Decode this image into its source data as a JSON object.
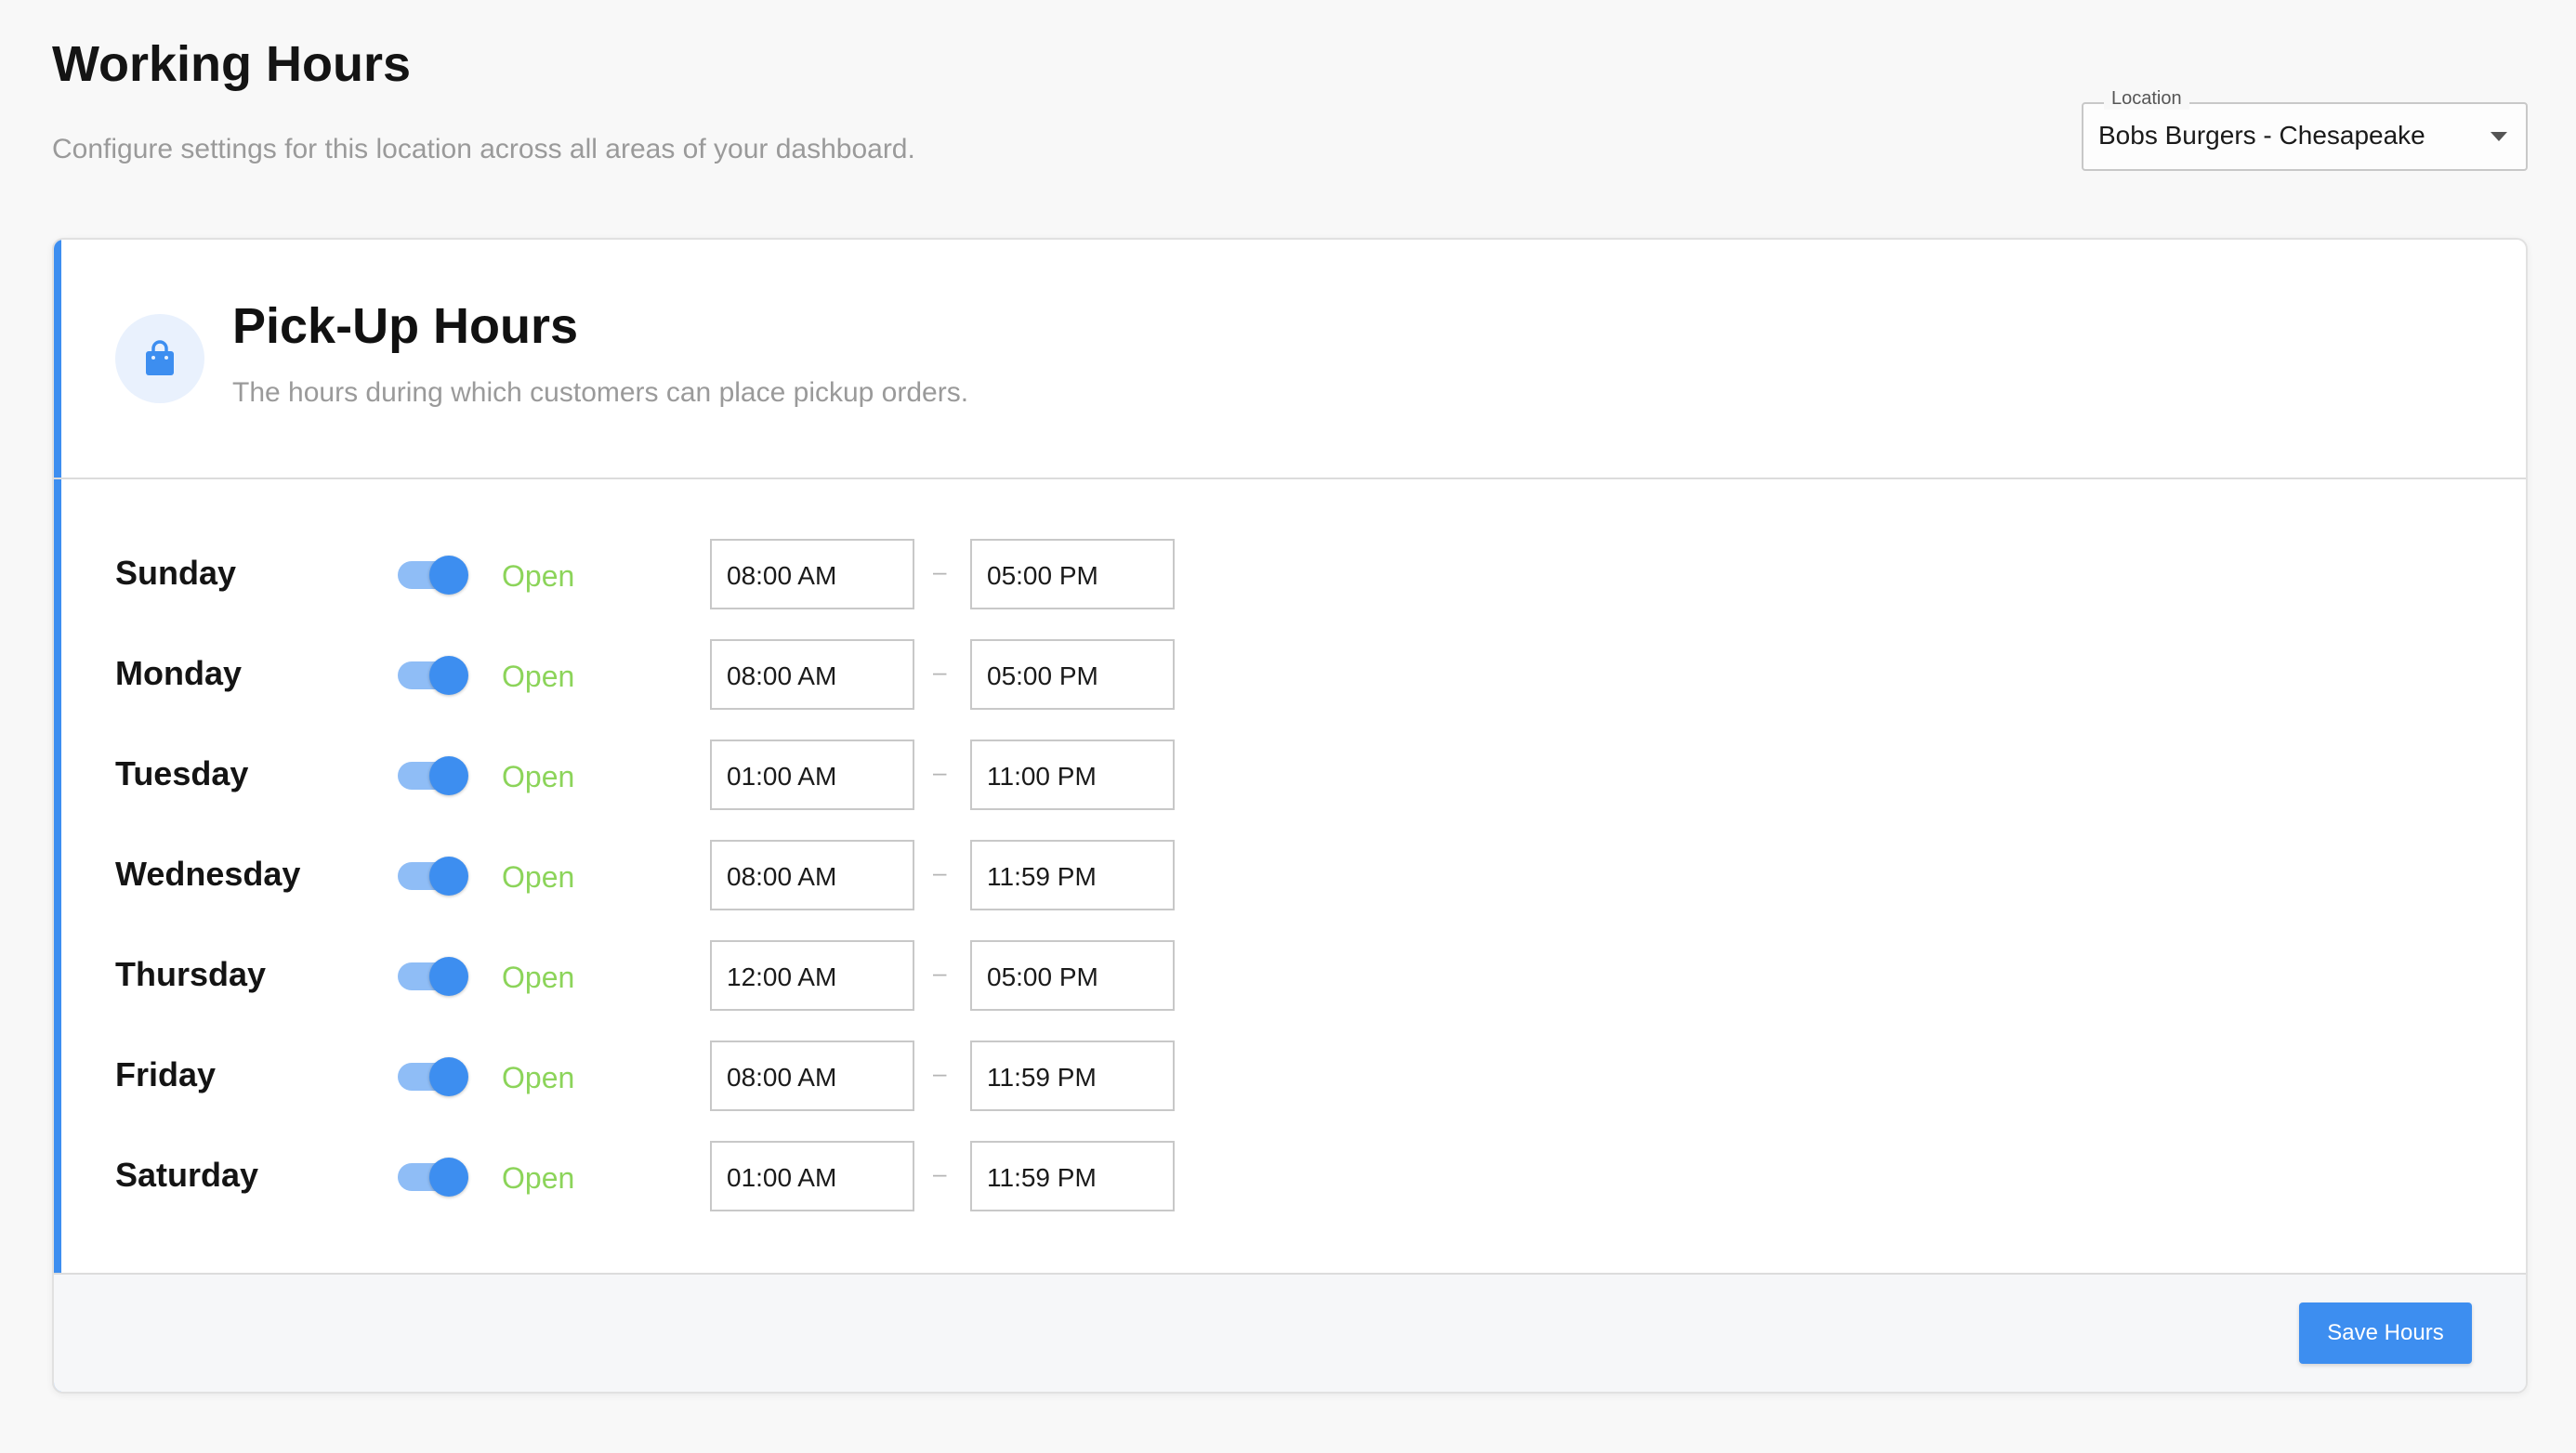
{
  "header": {
    "title": "Working Hours",
    "subtitle": "Configure settings for this location across all areas of your dashboard."
  },
  "location": {
    "label": "Location",
    "value": "Bobs Burgers - Chesapeake",
    "icon": "chevron-down-icon"
  },
  "pickup": {
    "icon": "shopping-bag-icon",
    "title": "Pick-Up Hours",
    "subtitle": "The hours during which customers can place pickup orders.",
    "separator": "–",
    "days": [
      {
        "day": "Sunday",
        "enabled": true,
        "status": "Open",
        "open": "08:00 AM",
        "close": "05:00 PM"
      },
      {
        "day": "Monday",
        "enabled": true,
        "status": "Open",
        "open": "08:00 AM",
        "close": "05:00 PM"
      },
      {
        "day": "Tuesday",
        "enabled": true,
        "status": "Open",
        "open": "01:00 AM",
        "close": "11:00 PM"
      },
      {
        "day": "Wednesday",
        "enabled": true,
        "status": "Open",
        "open": "08:00 AM",
        "close": "11:59 PM"
      },
      {
        "day": "Thursday",
        "enabled": true,
        "status": "Open",
        "open": "12:00 AM",
        "close": "05:00 PM"
      },
      {
        "day": "Friday",
        "enabled": true,
        "status": "Open",
        "open": "08:00 AM",
        "close": "11:59 PM"
      },
      {
        "day": "Saturday",
        "enabled": true,
        "status": "Open",
        "open": "01:00 AM",
        "close": "11:59 PM"
      }
    ],
    "save_label": "Save Hours"
  },
  "colors": {
    "accent": "#3d8ef0",
    "toggle_track": "#8fbdf6",
    "open_status": "#8cd45a",
    "muted_text": "#9a9a9a"
  }
}
